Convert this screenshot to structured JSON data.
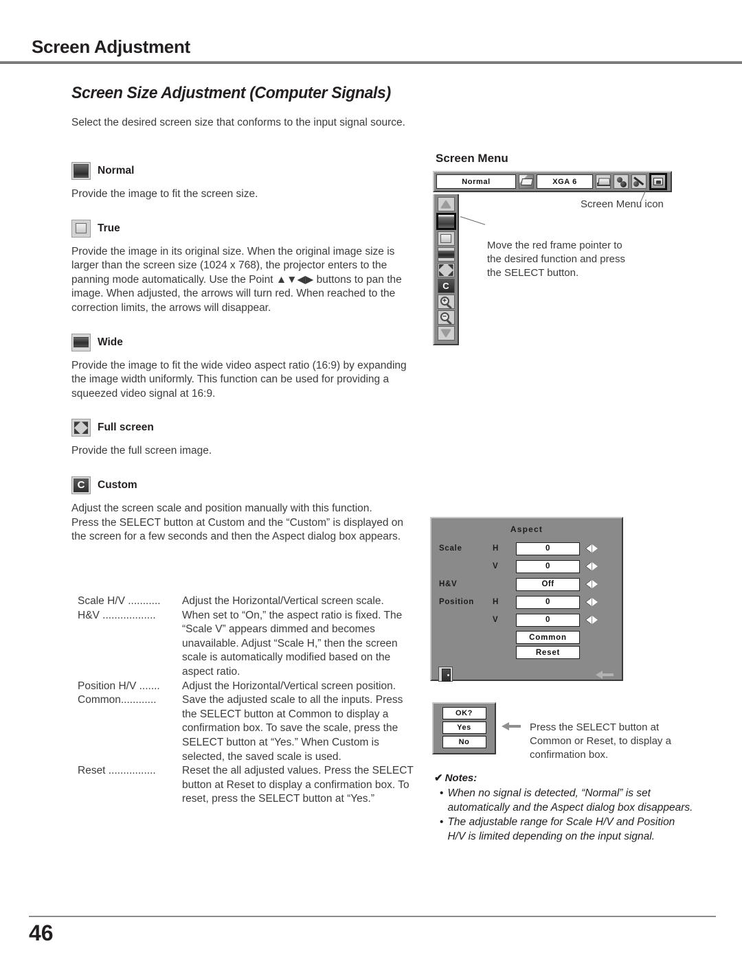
{
  "header": {
    "title": "Screen Adjustment",
    "section_title": "Screen Size Adjustment (Computer Signals)",
    "intro": "Select the desired screen size that conforms to the input signal source."
  },
  "modes": [
    {
      "icon": "normal-screen-icon",
      "label": "Normal",
      "body": "Provide the image to fit the screen size."
    },
    {
      "icon": "true-screen-icon",
      "label": "True",
      "body": "Provide the image in its original size. When the original image size is larger than the screen size (1024 x 768), the projector enters to the panning mode automatically. Use the Point ▲▼◀▶ buttons to pan the image. When adjusted, the arrows will turn red. When reached to the correction limits, the arrows will disappear."
    },
    {
      "icon": "wide-screen-icon",
      "label": "Wide",
      "body": "Provide the image to fit the wide video aspect ratio (16:9) by expanding the image width uniformly. This function can be used for providing a squeezed video signal at 16:9."
    },
    {
      "icon": "full-screen-icon",
      "label": "Full screen",
      "body": "Provide the full screen image."
    },
    {
      "icon": "custom-screen-icon",
      "label": "Custom",
      "body": "Adjust the screen scale and position manually with this function.\nPress the SELECT button at Custom and the “Custom” is displayed on the screen for a few seconds and then the Aspect dialog box appears."
    }
  ],
  "definitions": [
    {
      "term": "Scale H/V ...........",
      "desc": "Adjust the Horizontal/Vertical screen scale."
    },
    {
      "term": "H&V ..................",
      "desc": "When set to “On,” the aspect ratio is fixed. The “Scale V” appears dimmed and becomes unavailable. Adjust “Scale H,” then the screen scale is automatically modified based on the aspect ratio."
    },
    {
      "term": "Position H/V .......",
      "desc": "Adjust the Horizontal/Vertical screen position."
    },
    {
      "term": "Common............",
      "desc": "Save the adjusted scale to all the inputs. Press the SELECT button at Common to display a confirmation box. To save the scale, press the SELECT button at “Yes.” When Custom is selected, the saved scale is used."
    },
    {
      "term": "Reset ................",
      "desc": "Reset the all adjusted values. Press the SELECT button at Reset to display a confirmation box. To reset, press the SELECT button at “Yes.”"
    }
  ],
  "screen_menu": {
    "title": "Screen Menu",
    "bar": {
      "mode_value": "Normal",
      "signal_value": "XGA 6",
      "icons": [
        "input-source-icon",
        "computer-laptop-icon",
        "color-adjust-icon",
        "image-adjust-icon",
        "screen-menu-icon"
      ]
    },
    "strip_items": [
      "scroll-up-arrow",
      "normal-icon",
      "true-icon",
      "wide-icon",
      "full-screen-icon",
      "custom-icon",
      "zoom-in-icon",
      "zoom-out-icon",
      "scroll-down-arrow"
    ],
    "zoom_in_glyph": "+",
    "zoom_out_glyph": "−",
    "custom_glyph": "C",
    "callout_icon": "Screen Menu icon",
    "callout_move": "Move the red frame pointer to the desired function and press the SELECT button."
  },
  "aspect_dialog": {
    "title": "Aspect",
    "rows": [
      {
        "label": "Scale",
        "axis": "H",
        "value": "0"
      },
      {
        "label": "",
        "axis": "V",
        "value": "0"
      },
      {
        "label": "H&V",
        "axis": "",
        "value": "Off"
      },
      {
        "label": "Position",
        "axis": "H",
        "value": "0"
      },
      {
        "label": "",
        "axis": "V",
        "value": "0"
      }
    ],
    "buttons": [
      "Common",
      "Reset"
    ],
    "exit_icon": "exit-door-icon",
    "back_arrow": "back-arrow-icon"
  },
  "confirm_box": {
    "title": "OK?",
    "yes": "Yes",
    "no": "No",
    "caption": "Press the SELECT button at Common or Reset, to display a confirmation box."
  },
  "notes": {
    "check": "✔",
    "heading": "Notes:",
    "items": [
      "When no signal is detected, “Normal” is set automatically and the Aspect dialog box disappears.",
      "The adjustable range for Scale H/V and Position H/V is limited depending on the input signal."
    ]
  },
  "footer": {
    "page_number": "46"
  }
}
